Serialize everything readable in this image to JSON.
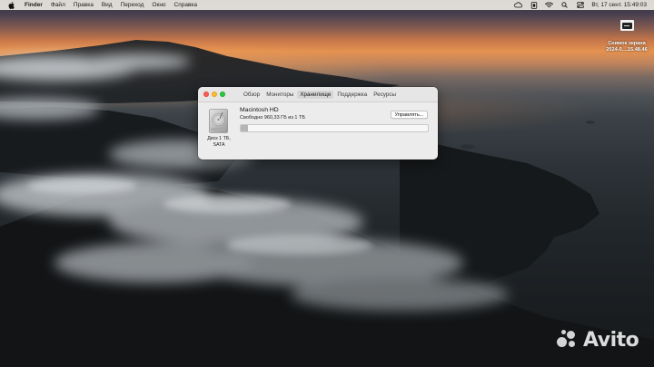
{
  "menubar": {
    "apple_icon": "apple-icon",
    "items": [
      "Finder",
      "Файл",
      "Правка",
      "Вид",
      "Переход",
      "Окно",
      "Справка"
    ],
    "status_icons": [
      "creative-cloud-icon",
      "screen-record-icon",
      "wifi-icon",
      "search-icon",
      "control-center-icon"
    ],
    "clock": "Вт, 17 сент.  15:49:03"
  },
  "desktop": {
    "file_name_line1": "Снимок экрана",
    "file_name_line2": "2024-0....15.48.46",
    "file_icon": "screenshot-file-icon"
  },
  "window": {
    "tabs": [
      {
        "label": "Обзор",
        "active": false
      },
      {
        "label": "Мониторы",
        "active": false
      },
      {
        "label": "Хранилище",
        "active": true
      },
      {
        "label": "Поддержка",
        "active": false
      },
      {
        "label": "Ресурсы",
        "active": false
      }
    ],
    "storage": {
      "disk_icon": "hard-drive-icon",
      "disk_caption_line1": "Диск 1 ТБ,",
      "disk_caption_line2": "SATA",
      "volume_name": "Macintosh HD",
      "free_text": "Свободно 960,33 ГБ из 1 ТБ",
      "used_fraction": 0.04,
      "manage_button": "Управлять..."
    }
  },
  "watermark": {
    "text": "Avito"
  }
}
